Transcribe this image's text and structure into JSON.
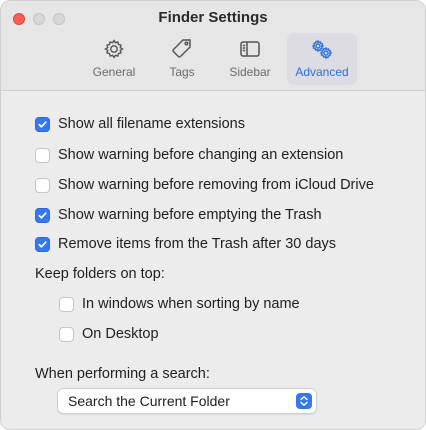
{
  "window": {
    "title": "Finder Settings"
  },
  "tabs": [
    {
      "label": "General",
      "icon": "gear-icon"
    },
    {
      "label": "Tags",
      "icon": "tag-icon"
    },
    {
      "label": "Sidebar",
      "icon": "sidebar-icon"
    },
    {
      "label": "Advanced",
      "icon": "gears-icon",
      "active": true
    }
  ],
  "options": [
    {
      "label": "Show all filename extensions",
      "checked": true
    },
    {
      "label": "Show warning before changing an extension",
      "checked": false
    },
    {
      "label": "Show warning before removing from iCloud Drive",
      "checked": false
    },
    {
      "label": "Show warning before emptying the Trash",
      "checked": true
    },
    {
      "label": "Remove items from the Trash after 30 days",
      "checked": true
    }
  ],
  "folders_on_top": {
    "heading": "Keep folders on top:",
    "items": [
      {
        "label": "In windows when sorting by name",
        "checked": false
      },
      {
        "label": "On Desktop",
        "checked": false
      }
    ]
  },
  "search": {
    "heading": "When performing a search:",
    "selected": "Search the Current Folder"
  },
  "colors": {
    "accent": "#3478f6",
    "close": "#fe5f57"
  }
}
